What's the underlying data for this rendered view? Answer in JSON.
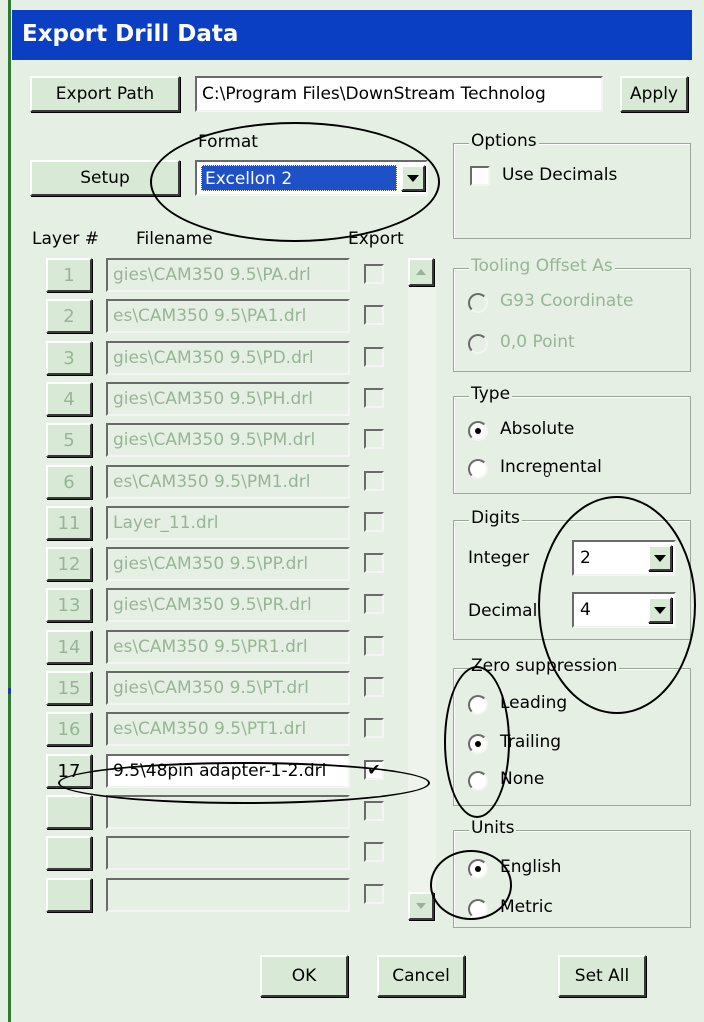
{
  "window": {
    "title": "Export Drill Data"
  },
  "export_path": {
    "button_label": "Export Path",
    "value": "C:\\Program Files\\DownStream Technolog",
    "apply_label": "Apply"
  },
  "setup": {
    "button_label": "Setup"
  },
  "format": {
    "label": "Format",
    "selected": "Excellon 2"
  },
  "columns": {
    "layer": "Layer #",
    "filename": "Filename",
    "export": "Export"
  },
  "layers": [
    {
      "num": "1",
      "file": "gies\\CAM350 9.5\\PA.drl",
      "checked": false,
      "active": false
    },
    {
      "num": "2",
      "file": "es\\CAM350 9.5\\PA1.drl",
      "checked": false,
      "active": false
    },
    {
      "num": "3",
      "file": "gies\\CAM350 9.5\\PD.drl",
      "checked": false,
      "active": false
    },
    {
      "num": "4",
      "file": "gies\\CAM350 9.5\\PH.drl",
      "checked": false,
      "active": false
    },
    {
      "num": "5",
      "file": "gies\\CAM350 9.5\\PM.drl",
      "checked": false,
      "active": false
    },
    {
      "num": "6",
      "file": "es\\CAM350 9.5\\PM1.drl",
      "checked": false,
      "active": false
    },
    {
      "num": "11",
      "file": "Layer_11.drl",
      "checked": false,
      "active": false
    },
    {
      "num": "12",
      "file": "gies\\CAM350 9.5\\PP.drl",
      "checked": false,
      "active": false
    },
    {
      "num": "13",
      "file": "gies\\CAM350 9.5\\PR.drl",
      "checked": false,
      "active": false
    },
    {
      "num": "14",
      "file": "es\\CAM350 9.5\\PR1.drl",
      "checked": false,
      "active": false
    },
    {
      "num": "15",
      "file": "gies\\CAM350 9.5\\PT.drl",
      "checked": false,
      "active": false
    },
    {
      "num": "16",
      "file": "es\\CAM350 9.5\\PT1.drl",
      "checked": false,
      "active": false
    },
    {
      "num": "17",
      "file": "9.5\\48pin adapter-1-2.drl",
      "checked": true,
      "active": true
    },
    {
      "num": "",
      "file": "",
      "checked": false,
      "active": false
    },
    {
      "num": "",
      "file": "",
      "checked": false,
      "active": false
    },
    {
      "num": "",
      "file": "",
      "checked": false,
      "active": false
    }
  ],
  "options": {
    "title": "Options",
    "use_decimals": "Use Decimals",
    "use_decimals_checked": false
  },
  "tooling": {
    "title": "Tooling Offset As",
    "opt1": "G93 Coordinate",
    "opt2": "0,0 Point"
  },
  "type": {
    "title": "Type",
    "opt1": "Absolute",
    "opt2": "Incremental",
    "selected": "Absolute"
  },
  "digits": {
    "title": "Digits",
    "integer_label": "Integer",
    "integer_value": "2",
    "decimal_label": "Decimal",
    "decimal_value": "4"
  },
  "zero": {
    "title": "Zero suppression",
    "opt1": "Leading",
    "opt2": "Trailing",
    "opt3": "None",
    "selected": "Trailing"
  },
  "units": {
    "title": "Units",
    "opt1": "English",
    "opt2": "Metric",
    "selected": "English"
  },
  "footer": {
    "ok": "OK",
    "cancel": "Cancel",
    "set_all": "Set All"
  },
  "colors": {
    "title_bar": "#0a3fc4",
    "dialog_bg": "#e6efe4",
    "disabled_text": "#97b596",
    "selection": "#1e50c8"
  }
}
